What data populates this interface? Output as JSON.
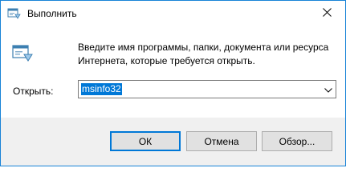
{
  "window": {
    "title": "Выполнить",
    "accent_color": "#0078d7"
  },
  "icons": {
    "title": "run-icon",
    "dialog": "run-icon",
    "close": "close-icon",
    "dropdown": "chevron-down-icon"
  },
  "description": {
    "line1": "Введите имя программы, папки, документа или ресурса",
    "line2": "Интернета, которые требуется открыть."
  },
  "open_field": {
    "label": "Открыть:",
    "value": "msinfo32"
  },
  "buttons": {
    "ok": "ОК",
    "cancel": "Отмена",
    "browse": "Обзор..."
  }
}
